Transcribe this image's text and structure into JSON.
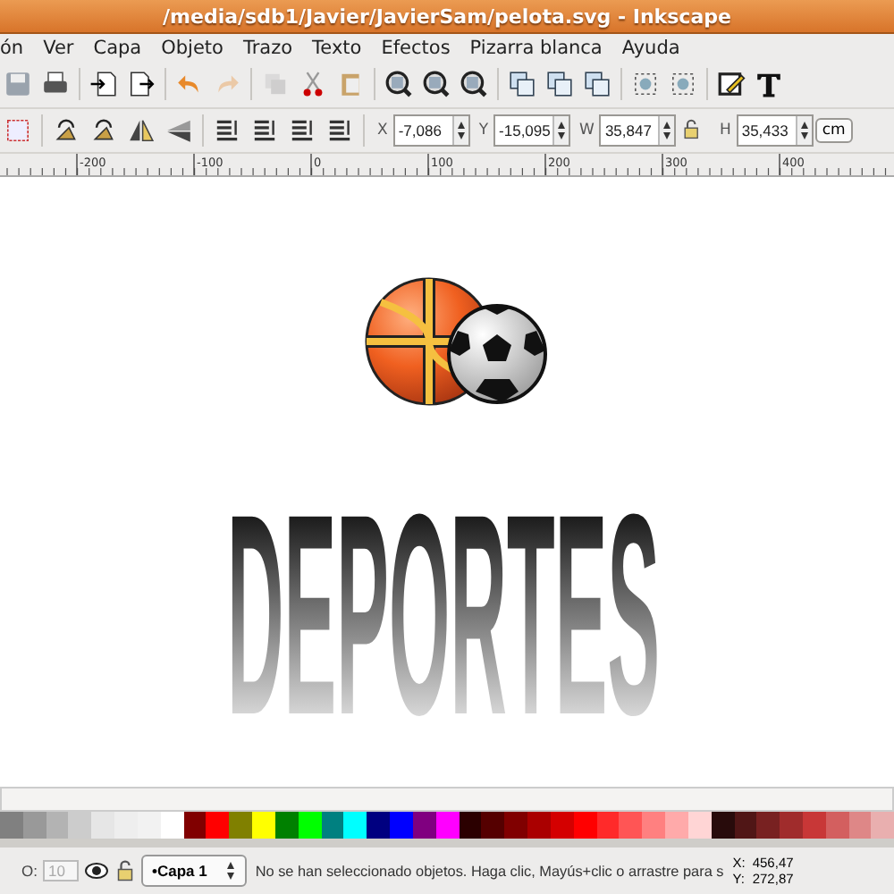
{
  "window": {
    "title": "/media/sdb1/Javier/JavierSam/pelota.svg - Inkscape"
  },
  "menu": [
    "ón",
    "Ver",
    "Capa",
    "Objeto",
    "Trazo",
    "Texto",
    "Efectos",
    "Pizarra blanca",
    "Ayuda"
  ],
  "toolbar": [
    {
      "kind": "save",
      "disabled": false
    },
    {
      "kind": "print",
      "disabled": false
    },
    {
      "kind": "sep"
    },
    {
      "kind": "import",
      "disabled": false
    },
    {
      "kind": "export",
      "disabled": false
    },
    {
      "kind": "sep"
    },
    {
      "kind": "undo",
      "disabled": false
    },
    {
      "kind": "redo",
      "disabled": true
    },
    {
      "kind": "sep"
    },
    {
      "kind": "duplicate",
      "disabled": true
    },
    {
      "kind": "cut",
      "disabled": false
    },
    {
      "kind": "paste",
      "disabled": false
    },
    {
      "kind": "sep"
    },
    {
      "kind": "zoom",
      "disabled": false
    },
    {
      "kind": "zoom",
      "disabled": false
    },
    {
      "kind": "zoom",
      "disabled": false
    },
    {
      "kind": "sep"
    },
    {
      "kind": "pages",
      "disabled": false
    },
    {
      "kind": "pages",
      "disabled": false
    },
    {
      "kind": "pages",
      "disabled": false
    },
    {
      "kind": "sep"
    },
    {
      "kind": "nodes",
      "disabled": false
    },
    {
      "kind": "nodes",
      "disabled": false
    },
    {
      "kind": "sep"
    },
    {
      "kind": "pen",
      "disabled": false
    },
    {
      "kind": "text",
      "disabled": false
    }
  ],
  "transform_toolbar": {
    "tools": [
      {
        "kind": "select"
      },
      {
        "kind": "sep"
      },
      {
        "kind": "rotate"
      },
      {
        "kind": "rotate"
      },
      {
        "kind": "flip-h"
      },
      {
        "kind": "flip-v"
      },
      {
        "kind": "sep"
      },
      {
        "kind": "order"
      },
      {
        "kind": "order"
      },
      {
        "kind": "order"
      },
      {
        "kind": "order"
      },
      {
        "kind": "sep"
      }
    ],
    "fields": [
      {
        "kind": "field",
        "label": "X",
        "value": "-7,086"
      },
      {
        "kind": "field",
        "label": "Y",
        "value": "-15,095"
      },
      {
        "kind": "field",
        "label": "W",
        "value": "35,847"
      },
      {
        "kind": "lock"
      },
      {
        "kind": "field",
        "label": "H",
        "value": "35,433"
      }
    ],
    "units": "cm"
  },
  "ruler": {
    "labels": [
      "-200",
      "-100",
      "0",
      "100",
      "200",
      "300",
      "400"
    ]
  },
  "canvas": {
    "artwork_text": "DEPORTES"
  },
  "palette": [
    {
      "color": "#808080"
    },
    {
      "color": "#999999"
    },
    {
      "color": "#b3b3b3"
    },
    {
      "color": "#cccccc"
    },
    {
      "color": "#e6e6e6"
    },
    {
      "color": "#eeeeee"
    },
    {
      "color": "#f2f2f2"
    },
    {
      "color": "#ffffff"
    },
    {
      "color": "#800000"
    },
    {
      "color": "#ff0000"
    },
    {
      "color": "#808000"
    },
    {
      "color": "#ffff00"
    },
    {
      "color": "#008000"
    },
    {
      "color": "#00ff00"
    },
    {
      "color": "#008080"
    },
    {
      "color": "#00ffff"
    },
    {
      "color": "#000080"
    },
    {
      "color": "#0000ff"
    },
    {
      "color": "#800080"
    },
    {
      "color": "#ff00ff"
    },
    {
      "color": "#2b0000"
    },
    {
      "color": "#550000"
    },
    {
      "color": "#800000"
    },
    {
      "color": "#aa0000"
    },
    {
      "color": "#d40000"
    },
    {
      "color": "#ff0000"
    },
    {
      "color": "#ff2a2a"
    },
    {
      "color": "#ff5555"
    },
    {
      "color": "#ff8080"
    },
    {
      "color": "#ffaaaa"
    },
    {
      "color": "#ffd5d5"
    },
    {
      "color": "#280b0b"
    },
    {
      "color": "#501616"
    },
    {
      "color": "#782121"
    },
    {
      "color": "#a02c2c"
    },
    {
      "color": "#c83737"
    },
    {
      "color": "#d35f5f"
    },
    {
      "color": "#de8787"
    },
    {
      "color": "#e9afaf"
    }
  ],
  "status_bar": {
    "opacity_label": "O:",
    "opacity_value": "10",
    "layer": "•Capa 1",
    "message": "No se han seleccionado objetos. Haga clic, Mayús+clic o arrastre para s",
    "x_label": "X:",
    "x_value": "456,47",
    "y_label": "Y:",
    "y_value": "272,87"
  }
}
